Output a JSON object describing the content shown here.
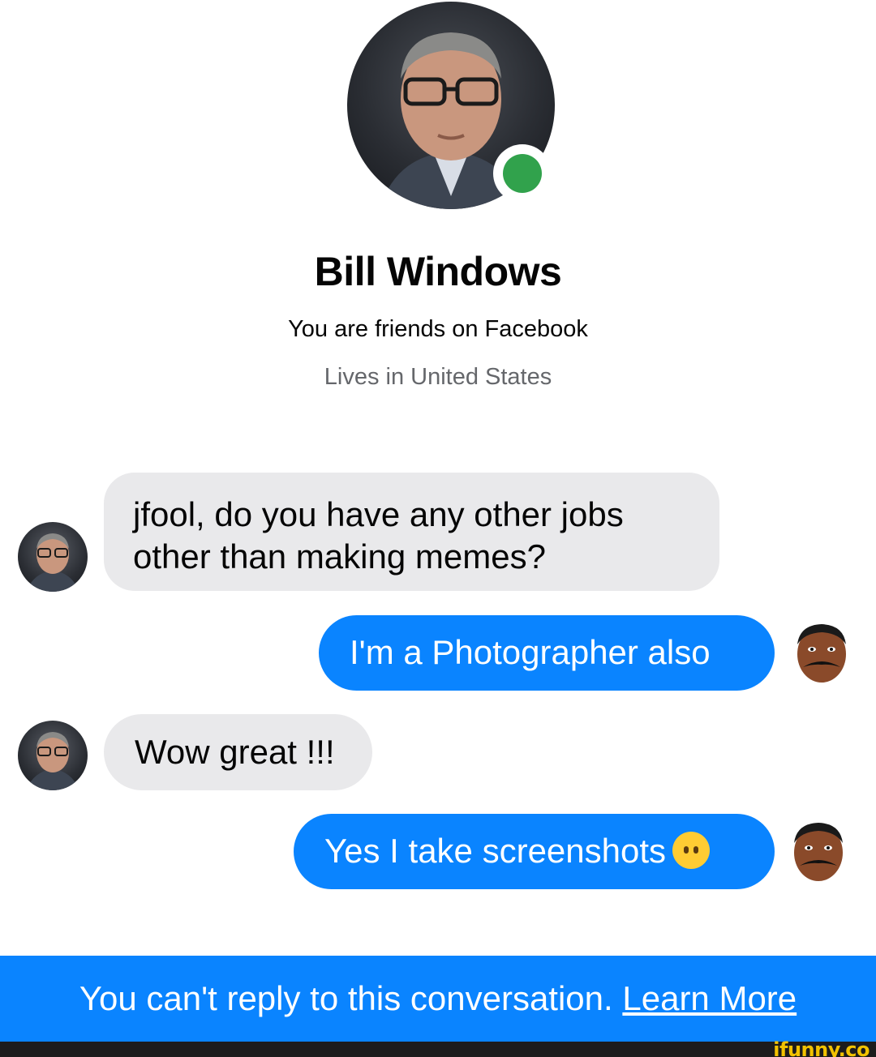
{
  "profile": {
    "name": "Bill Windows",
    "friends_text": "You are friends on Facebook",
    "lives_text": "Lives in United States",
    "online": true
  },
  "messages": [
    {
      "from": "them",
      "lines": [
        "jfool, do you have any other jobs",
        "other than making memes?"
      ]
    },
    {
      "from": "me",
      "lines": [
        "I'm a Photographer also"
      ]
    },
    {
      "from": "them",
      "lines": [
        "Wow great !!!"
      ]
    },
    {
      "from": "me",
      "lines": [
        "Yes I take screenshots"
      ],
      "emoji": "neutral-face-emoji"
    }
  ],
  "footer": {
    "text": "You can't reply to this conversation.",
    "link": "Learn More"
  },
  "watermark": "ifunny.co",
  "colors": {
    "outgoing_bubble": "#0a84ff",
    "incoming_bubble": "#e9e9eb",
    "online_dot": "#31a24c",
    "footer_bar": "#0a84ff",
    "secondary_text": "#65676b",
    "watermark": "#f2c200"
  }
}
